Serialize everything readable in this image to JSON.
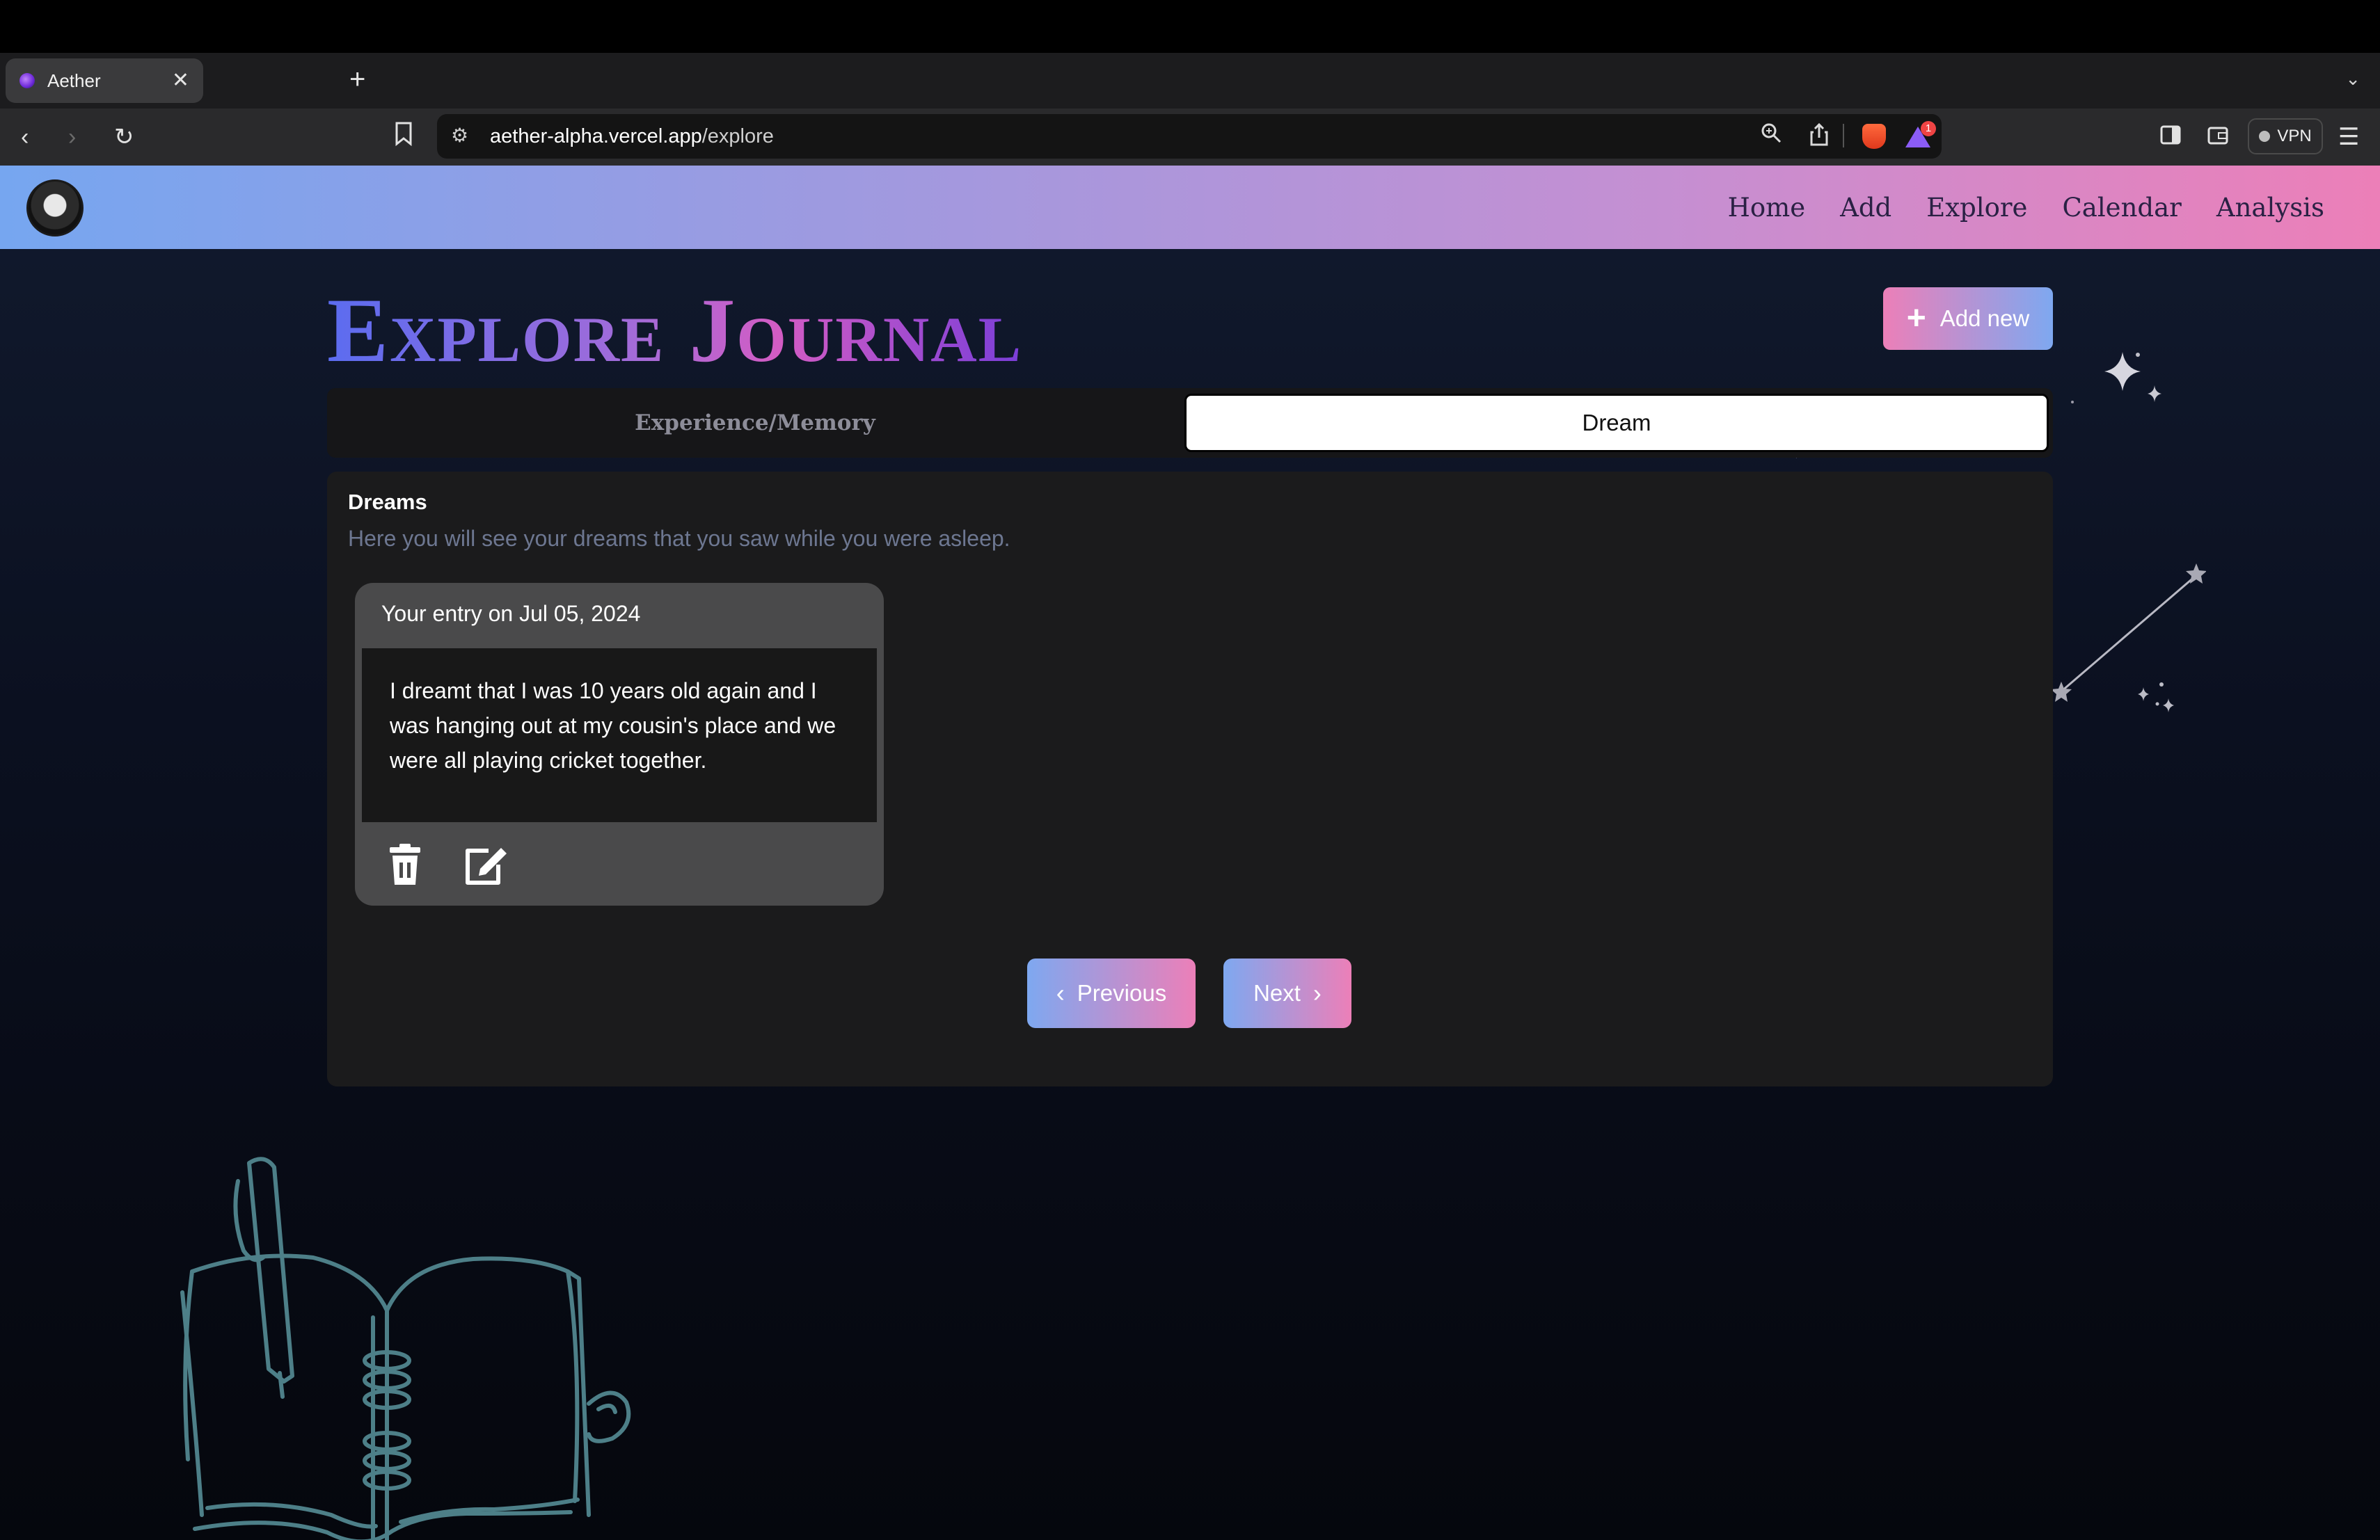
{
  "browser": {
    "tab_title": "Aether",
    "new_tab_symbol": "+",
    "close_symbol": "✕",
    "url_host": "aether-alpha.vercel.app",
    "url_path": "/explore",
    "rewards_badge": "1",
    "vpn_label": "VPN"
  },
  "nav": {
    "links": [
      "Home",
      "Add",
      "Explore",
      "Calendar",
      "Analysis"
    ]
  },
  "page": {
    "title": "Explore Journal",
    "add_new_label": "Add new",
    "tabs": [
      "Experience/Memory",
      "Dream"
    ],
    "active_tab": "Dream",
    "section_title": "Dreams",
    "section_subtitle": "Here you will see your dreams that you saw while you were asleep.",
    "entries": [
      {
        "header": "Your entry on Jul 05, 2024",
        "text": "I dreamt that I was 10 years old again and I was hanging out at my cousin's place and we were all playing cricket together."
      }
    ],
    "pagination": {
      "previous_label": "Previous",
      "next_label": "Next"
    }
  },
  "colors": {
    "nav_gradient_start": "#76a6f0",
    "nav_gradient_end": "#ec7fb8",
    "button_pink": "#ec7fb8",
    "button_blue": "#7ea8f0",
    "panel_bg": "#1b1b1c",
    "card_bg": "#4a4a4b",
    "doodle_stroke": "#4d7f88"
  },
  "icons": {
    "entry_actions": [
      "trash-icon",
      "edit-icon"
    ],
    "decorations": [
      "sparkle-icon",
      "constellation-icon",
      "notebook-pen-illustration"
    ]
  }
}
